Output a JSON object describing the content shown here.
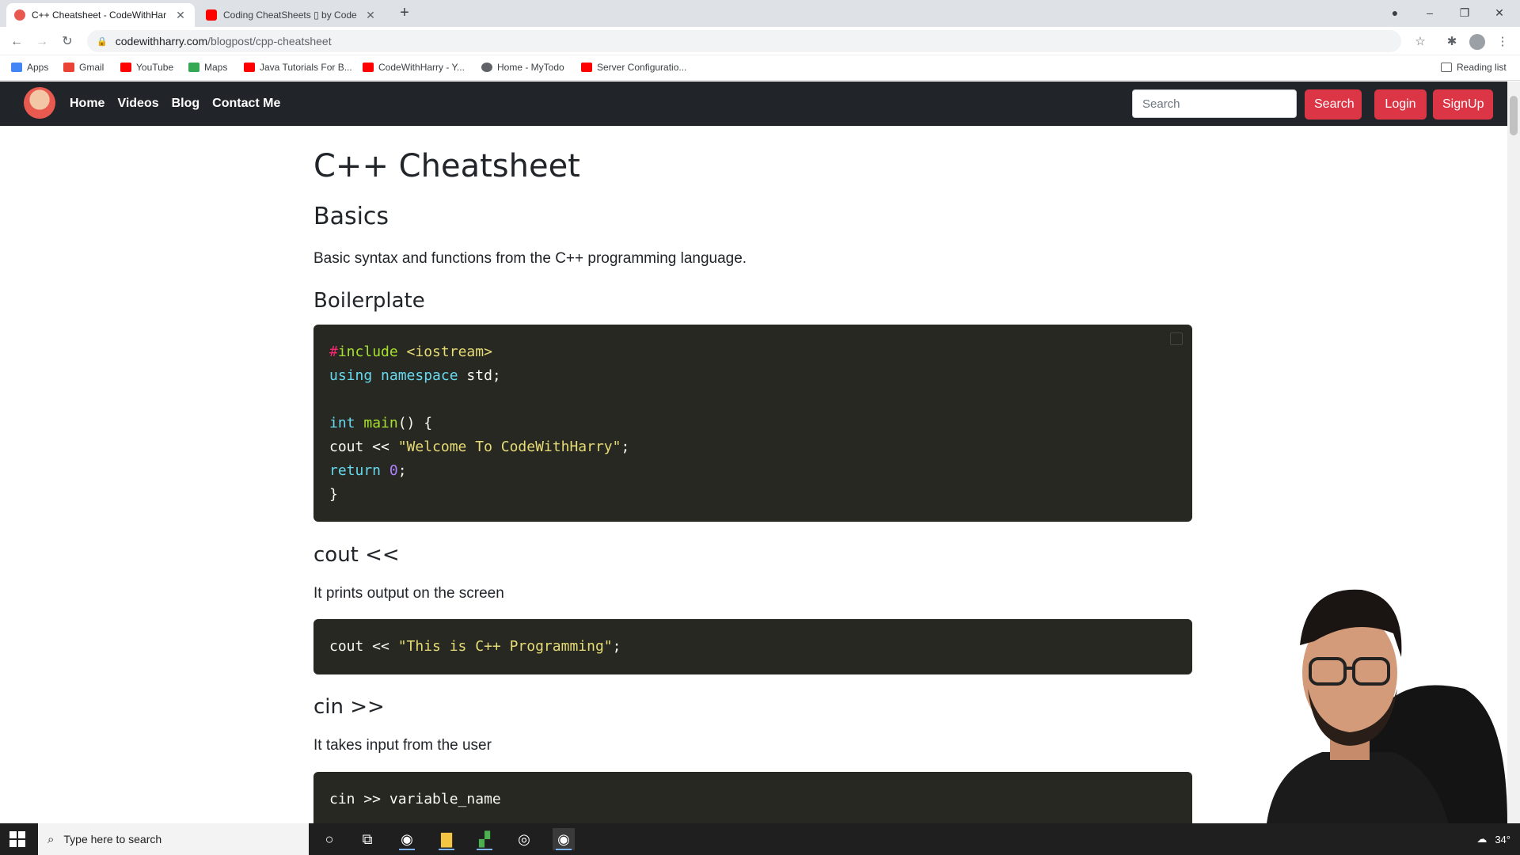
{
  "browser": {
    "tabs": [
      {
        "title": "C++ Cheatsheet - CodeWithHar",
        "active": true,
        "favicon_color": "#e85a4f"
      },
      {
        "title": "Coding CheatSheets ▯ by Code",
        "active": false,
        "favicon_color": "#ff0000"
      }
    ],
    "new_tab_label": "+",
    "url_host": "codewithharry.com",
    "url_path": "/blogpost/cpp-cheatsheet",
    "bookmarks": [
      {
        "label": "Apps",
        "color": "#4285f4"
      },
      {
        "label": "Gmail",
        "color": "#ea4335"
      },
      {
        "label": "YouTube",
        "color": "#ff0000"
      },
      {
        "label": "Maps",
        "color": "#34a853"
      },
      {
        "label": "Java Tutorials For B...",
        "color": "#ff0000"
      },
      {
        "label": "CodeWithHarry - Y...",
        "color": "#ff0000"
      },
      {
        "label": "Home - MyTodo",
        "color": "#5f6368"
      },
      {
        "label": "Server Configuratio...",
        "color": "#ff0000"
      }
    ],
    "reading_list": "Reading list"
  },
  "site_nav": {
    "links": [
      "Home",
      "Videos",
      "Blog",
      "Contact Me"
    ],
    "search_placeholder": "Search",
    "search_button": "Search",
    "login_button": "Login",
    "signup_button": "SignUp",
    "accent_color": "#dc3545"
  },
  "content": {
    "title": "C++ Cheatsheet",
    "basics_heading": "Basics",
    "basics_desc": "Basic syntax and functions from the C++ programming language.",
    "boilerplate_heading": "Boilerplate",
    "boilerplate_code": [
      "#include <iostream>",
      "using namespace std;",
      "",
      "int main() {",
      "cout << \"Welcome To CodeWithHarry\";",
      "return 0;",
      "}"
    ],
    "cout_heading": "cout <<",
    "cout_desc": "It prints output on the screen",
    "cout_code": "cout << \"This is C++ Programming\";",
    "cin_heading": "cin >>",
    "cin_desc": "It takes input from the user",
    "cin_code": "cin >> variable_name"
  },
  "taskbar": {
    "search_placeholder": "Type here to search",
    "weather": "34°"
  }
}
